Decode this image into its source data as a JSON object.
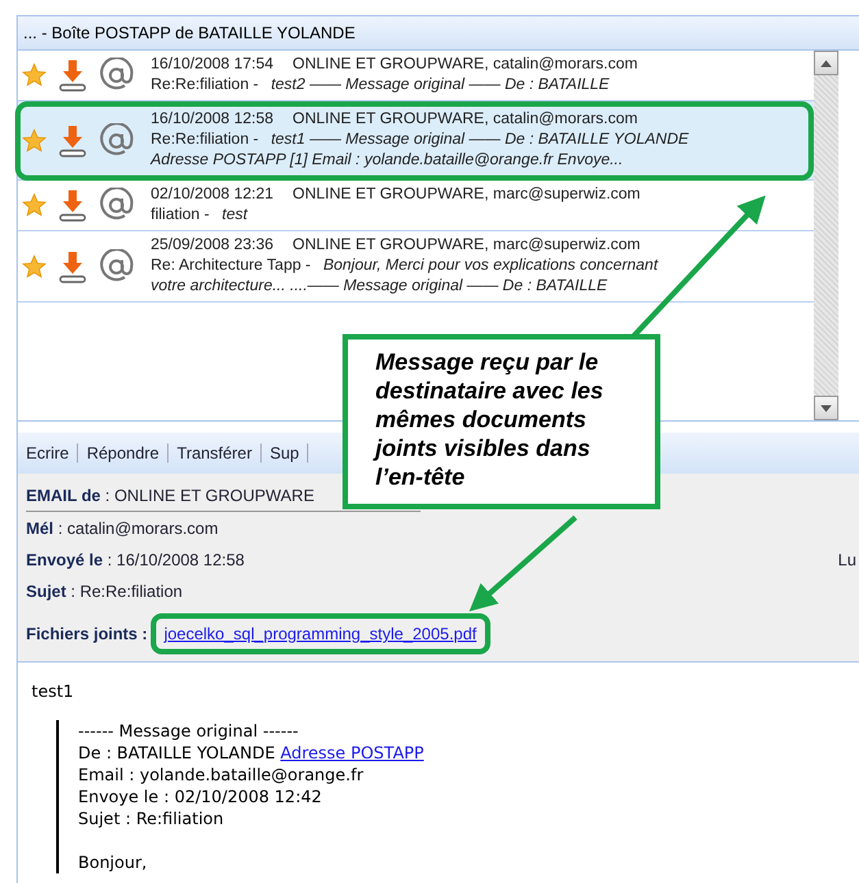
{
  "mailbox": {
    "title": "... - Boîte POSTAPP de BATAILLE YOLANDE"
  },
  "messages": [
    {
      "date": "16/10/2008 17:54",
      "sender": "ONLINE ET GROUPWARE, catalin@morars.com",
      "subject": "Re:Re:filiation - ",
      "preview": "test2 —— Message original —— De : BATAILLE",
      "selected": false
    },
    {
      "date": "16/10/2008 12:58",
      "sender": "ONLINE ET GROUPWARE, catalin@morars.com",
      "subject": "Re:Re:filiation - ",
      "preview": "test1 —— Message original —— De : BATAILLE YOLANDE Adresse POSTAPP [1] Email : yolande.bataille@orange.fr Envoye...",
      "selected": true
    },
    {
      "date": "02/10/2008 12:21",
      "sender": "ONLINE ET GROUPWARE, marc@superwiz.com",
      "subject": "filiation - ",
      "preview": "test",
      "selected": false
    },
    {
      "date": "25/09/2008 23:36",
      "sender": "ONLINE ET GROUPWARE, marc@superwiz.com",
      "subject": "Re: Architecture Tapp - ",
      "preview": "Bonjour, Merci pour vos explications concernant votre architecture... ....—— Message original —— De : BATAILLE",
      "selected": false
    }
  ],
  "toolbar": [
    "Ecrire",
    "Répondre",
    "Transférer",
    "Sup"
  ],
  "header_fields": [
    {
      "label": "EMAIL de",
      "value": ": ONLINE ET GROUPWARE"
    },
    {
      "label": "Mél",
      "value": ": catalin@morars.com"
    },
    {
      "label": "Envoyé le",
      "value": ": 16/10/2008 12:58",
      "side": "Lu"
    },
    {
      "label": "Sujet",
      "value": ": Re:Re:filiation"
    }
  ],
  "attachments": {
    "label": "Fichiers joints :",
    "files": [
      "joecelko_sql_programming_style_2005.pdf"
    ]
  },
  "body": {
    "first_line": "test1",
    "quote": [
      {
        "kind": "line",
        "text": "------ Message original ------"
      },
      {
        "kind": "line",
        "text": "De : BATAILLE YOLANDE ",
        "link": "Adresse POSTAPP"
      },
      {
        "kind": "line",
        "text": "Email : yolande.bataille@orange.fr"
      },
      {
        "kind": "line",
        "text": "Envoye le : 02/10/2008 12:42"
      },
      {
        "kind": "line",
        "text": "Sujet : Re:filiation"
      },
      {
        "kind": "blank"
      },
      {
        "kind": "line",
        "text": "Bonjour,"
      }
    ]
  },
  "annotation": {
    "text": "Message reçu par le destinataire avec les mêmes documents joints visibles dans l’en-tête"
  }
}
